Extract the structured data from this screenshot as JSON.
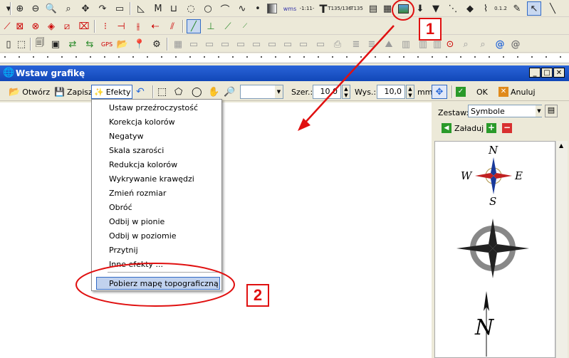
{
  "dialog": {
    "title": "Wstaw grafikę",
    "toolbar": {
      "open_label": "Otwórz",
      "save_label": "Zapisz",
      "effects_label": "Efekty",
      "width_label": "Szer.:",
      "width_value": "10,0",
      "height_label": "Wys.:",
      "height_value": "10,0",
      "unit_label": "mm",
      "ok_label": "OK",
      "cancel_label": "Anuluj"
    },
    "side": {
      "set_label": "Zestaw:",
      "set_value": "Symbole",
      "load_label": "Załaduj"
    },
    "symbols": {
      "n1": "N",
      "s1": "S",
      "w1": "W",
      "e1": "E",
      "n3": "N"
    }
  },
  "effects_menu": {
    "items": [
      "Ustaw przeźroczystość",
      "Korekcja kolorów",
      "Negatyw",
      "Skala szarości",
      "Redukcja kolorów",
      "Wykrywanie krawędzi",
      "Zmień rozmiar",
      "Obróć",
      "Odbij w pionie",
      "Odbij w poziomie",
      "Przytnij",
      "Inne efekty ..."
    ],
    "highlighted": "Pobierz mapę topograficzną"
  },
  "toolbar_top": {
    "text_tools": [
      "wms",
      "-1:11-",
      "T",
      "T135/136",
      "T135"
    ],
    "coord_label": "0.1.2"
  },
  "callouts": {
    "one": "1",
    "two": "2"
  },
  "colors": {
    "callout_red": "#e01010",
    "titlebar": "#1f58c8",
    "menu_highlight": "#c1d2ee"
  }
}
